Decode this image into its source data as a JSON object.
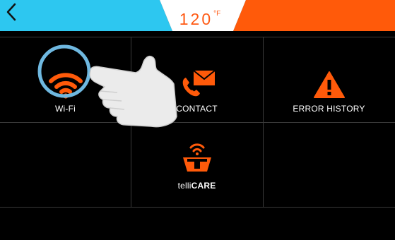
{
  "header": {
    "back_icon": "chevron-left-icon",
    "temperature": {
      "value": "120",
      "unit": "°F"
    },
    "colors": {
      "left_bar": "#2dc7f0",
      "right_bar": "#ff5a0a",
      "center_tab": "#ffffff",
      "temperature_text": "#ff5a14"
    }
  },
  "menu": {
    "items": [
      {
        "label": "Wi-Fi",
        "icon": "wifi-icon"
      },
      {
        "label": "CONTACT",
        "icon": "phone-mail-icon"
      },
      {
        "label": "ERROR HISTORY",
        "icon": "warning-icon"
      },
      {
        "label_light": "telli",
        "label_bold": "CARE",
        "icon": "tellicare-icon"
      }
    ]
  },
  "overlay": {
    "icon": "pointing-hand-icon",
    "highlight_color": "#6fb8e0"
  }
}
